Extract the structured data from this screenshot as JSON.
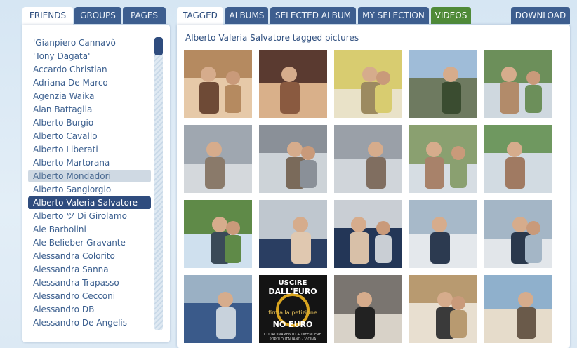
{
  "left_tabs": [
    {
      "label": "FRIENDS",
      "active": true
    },
    {
      "label": "GROUPS",
      "active": false
    },
    {
      "label": "PAGES",
      "active": false
    }
  ],
  "right_tabs": [
    {
      "label": "TAGGED",
      "active": true
    },
    {
      "label": "ALBUMS",
      "active": false
    },
    {
      "label": "SELECTED ALBUM",
      "active": false
    },
    {
      "label": "MY SELECTION",
      "active": false
    },
    {
      "label": "VIDEOS",
      "active": false,
      "accent": "#4f8a38"
    },
    {
      "label": "DOWNLOAD",
      "active": false
    }
  ],
  "friends": [
    "'Gianpiero Cannavò",
    "'Tony Dagata'",
    "Accardo Christian",
    "Adriana De Marco",
    "Agenzia Waika",
    "Alan Battaglia",
    "Alberto Burgio",
    "Alberto Cavallo",
    "Alberto Liberati",
    "Alberto Martorana",
    "Alberto Mondadori",
    "Alberto Sangiorgio",
    "Alberto Valeria Salvatore",
    "Alberto ツ Di Girolamo",
    "Ale Barbolini",
    "Ale Belieber Gravante",
    "Alessandra Colorito",
    "Alessandra Sanna",
    "Alessandra Trapasso",
    "Alessandro Cecconi",
    "Alessandro DB",
    "Alessandro De Angelis"
  ],
  "friends_state": {
    "hover_index": 10,
    "selected_index": 12
  },
  "photos_title": "Alberto Valeria Salvatore tagged pictures",
  "photo_texts": {
    "line1": "USCIRE",
    "line2": "DALL'EURO",
    "line3": "firma la petizione",
    "line4": "NO EURO",
    "line5": "COORDINAMENTO + DIFENDERE",
    "line6": "POPOLO ITALIANO - VICINA"
  },
  "colors": {
    "tab_bg": "#3d5e8f",
    "selected_bg": "#2f4c7e",
    "hover_bg": "#cfd9e3",
    "link": "#3a5e8e",
    "videos_tab": "#4f8a38"
  }
}
